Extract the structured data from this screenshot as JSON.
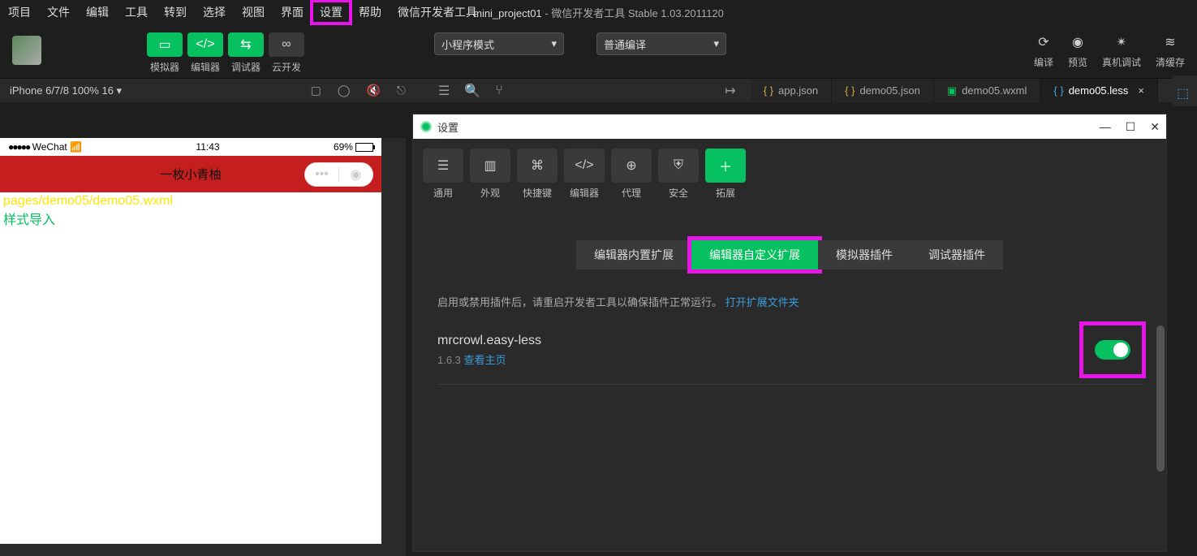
{
  "menu": [
    "项目",
    "文件",
    "编辑",
    "工具",
    "转到",
    "选择",
    "视图",
    "界面",
    "设置",
    "帮助",
    "微信开发者工具"
  ],
  "window_title": {
    "project": "mini_project01",
    "suffix": " - 微信开发者工具 Stable 1.03.2011120"
  },
  "toolbar": {
    "simulator": "模拟器",
    "editor": "编辑器",
    "debugger": "调试器",
    "cloud": "云开发",
    "mode_dropdown": "小程序模式",
    "compile_dropdown": "普通编译",
    "compile": "编译",
    "preview": "预览",
    "real": "真机调试",
    "clear": "清缓存"
  },
  "device_info": "iPhone 6/7/8 100% 16 ▾",
  "tabs": [
    {
      "label": "app.json",
      "type": "brace"
    },
    {
      "label": "demo05.json",
      "type": "brace"
    },
    {
      "label": "demo05.wxml",
      "type": "wx"
    },
    {
      "label": "demo05.less",
      "type": "brace-blue",
      "active": true
    }
  ],
  "sim": {
    "wechat": "WeChat",
    "time": "11:43",
    "battery": "69%",
    "nav_title": "一枚小青柚",
    "path": "pages/demo05/demo05.wxml",
    "style_import": "样式导入"
  },
  "settings": {
    "title": "设置",
    "tabs": [
      "通用",
      "外观",
      "快捷键",
      "编辑器",
      "代理",
      "安全",
      "拓展"
    ],
    "ext_tabs": [
      "编辑器内置扩展",
      "编辑器自定义扩展",
      "模拟器插件",
      "调试器插件"
    ],
    "hint": "启用或禁用插件后，请重启开发者工具以确保插件正常运行。",
    "hint_link": "打开扩展文件夹",
    "ext": {
      "name": "mrcrowl.easy-less",
      "version": "1.6.3",
      "view": "查看主页"
    }
  }
}
